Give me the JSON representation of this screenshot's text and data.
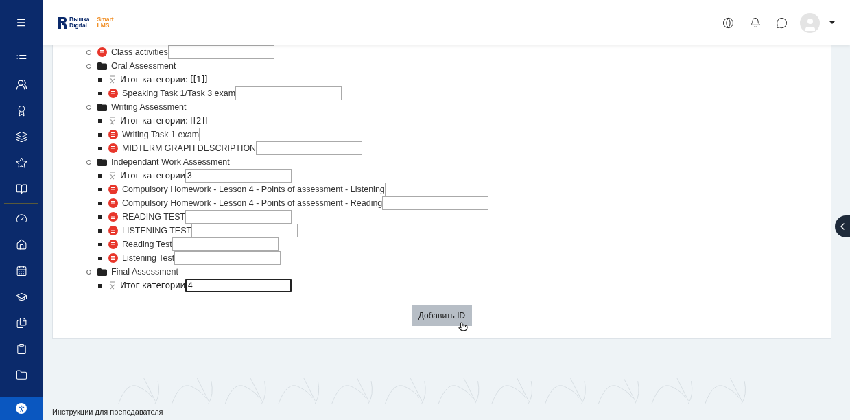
{
  "header": {
    "logo_top": "Вышка",
    "logo_bottom": "Digital",
    "product_top": "Smart",
    "product_bottom": "LMS"
  },
  "tree": [
    {
      "kind": "activity",
      "label": "Class activities",
      "focused": false
    },
    {
      "kind": "category",
      "label": "Oral Assessment",
      "children": [
        {
          "kind": "total",
          "label": "Итог категории: [[1]]"
        },
        {
          "kind": "activity",
          "label": "Speaking Task 1/Task 3 exam",
          "focused": false
        }
      ]
    },
    {
      "kind": "category",
      "label": "Writing Assessment",
      "children": [
        {
          "kind": "total",
          "label": "Итог категории: [[2]]"
        },
        {
          "kind": "activity",
          "label": "Writing Task 1 exam",
          "focused": false
        },
        {
          "kind": "activity",
          "label": "MIDTERM GRAPH DESCRIPTION",
          "focused": false
        }
      ]
    },
    {
      "kind": "category",
      "label": "Independant Work Assessment",
      "children": [
        {
          "kind": "total",
          "label": "Итог категории",
          "value": "3",
          "focused": false
        },
        {
          "kind": "activity",
          "label": "Compulsory Homework - Lesson 4 - Points of assessment - Listening",
          "focused": false
        },
        {
          "kind": "activity",
          "label": "Compulsory Homework - Lesson 4 - Points of assessment - Reading",
          "focused": false
        },
        {
          "kind": "activity",
          "label": "READING TEST",
          "focused": false
        },
        {
          "kind": "activity",
          "label": "LISTENING TEST",
          "focused": false
        },
        {
          "kind": "activity",
          "label": "Reading Test",
          "focused": false
        },
        {
          "kind": "activity",
          "label": "Listening Test",
          "focused": false
        }
      ]
    },
    {
      "kind": "category",
      "label": "Final Assessment",
      "children": [
        {
          "kind": "total",
          "label": "Итог категории",
          "value": "4",
          "focused": true
        }
      ]
    }
  ],
  "submit_button": "Добавить ID",
  "footer_link": "Инструкции для преподавателя"
}
